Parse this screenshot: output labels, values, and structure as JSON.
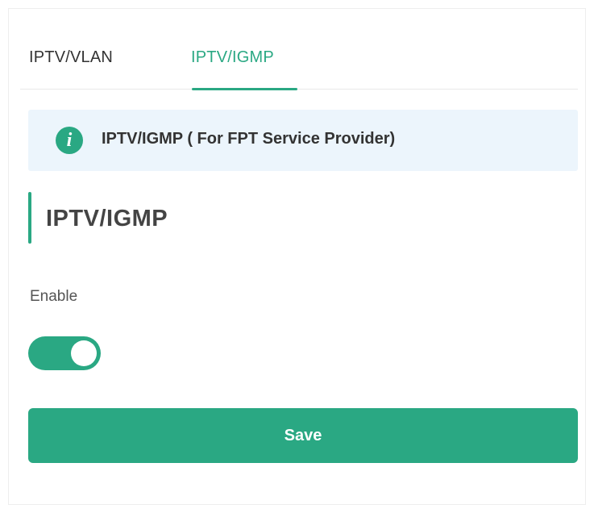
{
  "tabs": [
    {
      "label": "IPTV/VLAN",
      "active": false
    },
    {
      "label": "IPTV/IGMP",
      "active": true
    }
  ],
  "banner": {
    "icon": "info-icon",
    "icon_glyph": "i",
    "text": "IPTV/IGMP ( For FPT Service Provider)"
  },
  "section": {
    "title": "IPTV/IGMP"
  },
  "enable": {
    "label": "Enable",
    "on": true
  },
  "save_label": "Save",
  "colors": {
    "accent": "#2aa883",
    "banner_bg": "#ecf5fc",
    "text": "#333333"
  }
}
